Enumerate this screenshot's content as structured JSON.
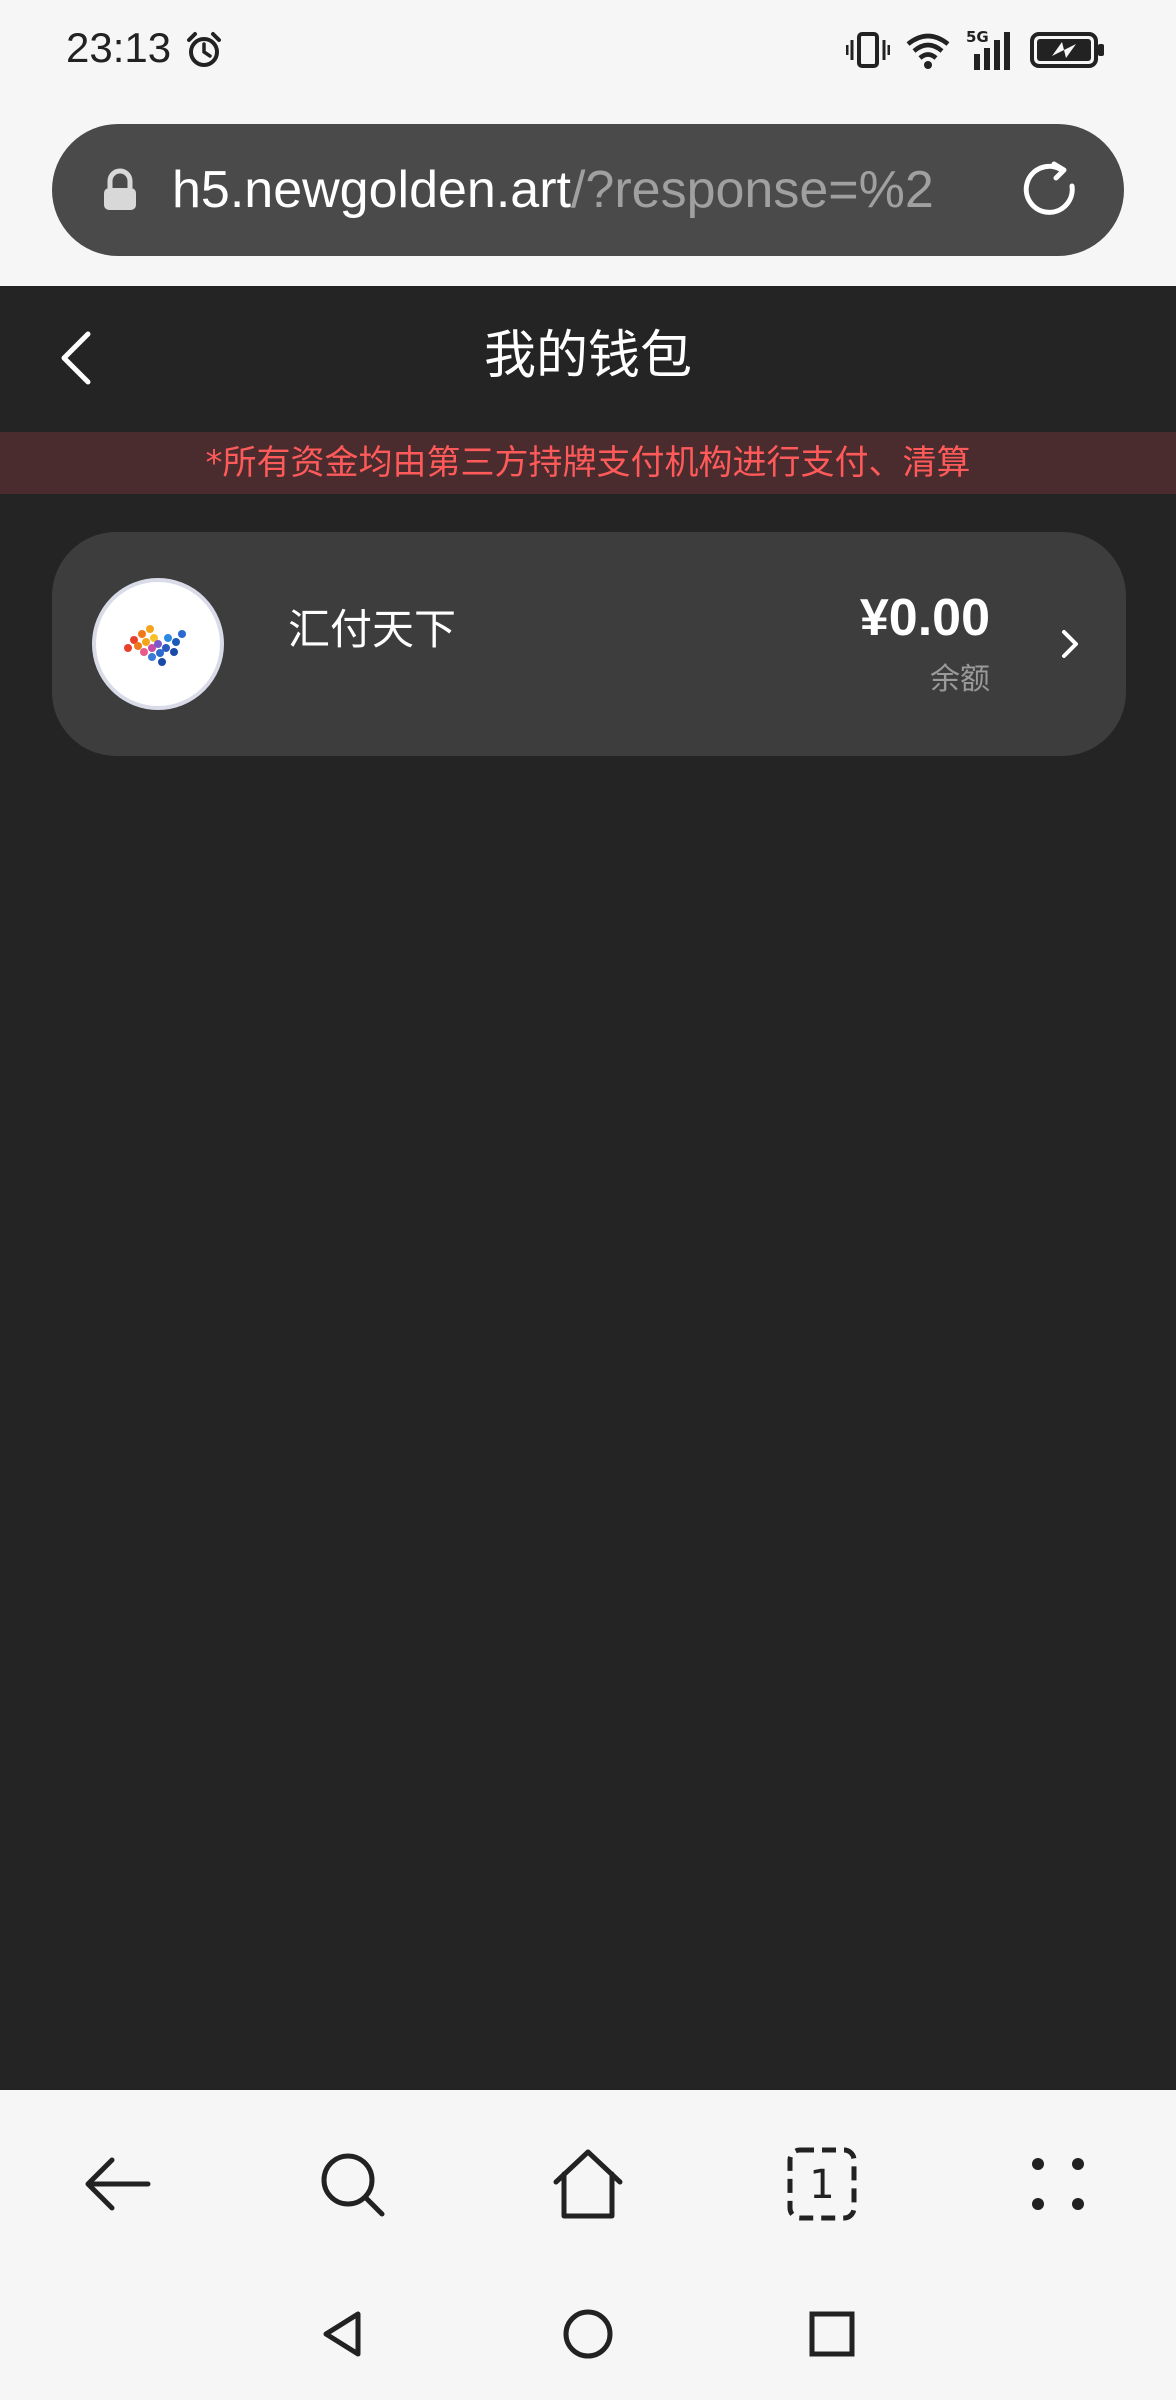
{
  "status_bar": {
    "time": "23:13",
    "network": "5G"
  },
  "browser": {
    "url_domain": "h5.newgolden.art",
    "url_rest": "/?response=%2"
  },
  "header": {
    "title": "我的钱包"
  },
  "notice": {
    "text": "*所有资金均由第三方持牌支付机构进行支付、清算"
  },
  "wallet": {
    "provider_name": "汇付天下",
    "balance": "¥0.00",
    "balance_label": "余额"
  },
  "browser_nav": {
    "tabs_count": "1"
  },
  "colors": {
    "background": "#242424",
    "card": "#3d3d3d",
    "notice_text": "#ff5a5a",
    "notice_bg": "#4a2b2e"
  }
}
